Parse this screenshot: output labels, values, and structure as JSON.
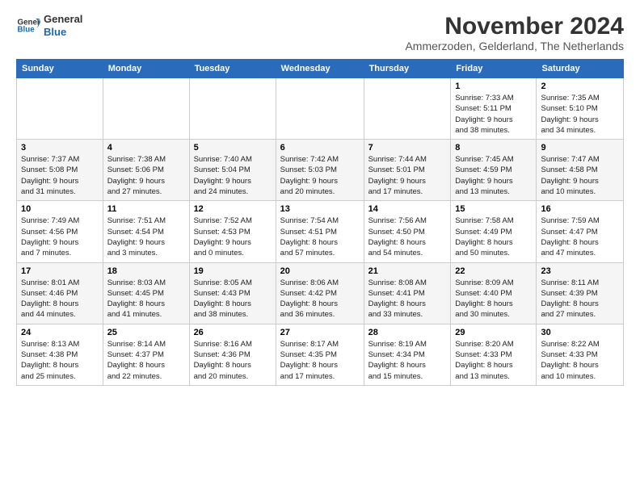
{
  "logo": {
    "line1": "General",
    "line2": "Blue"
  },
  "title": "November 2024",
  "subtitle": "Ammerzoden, Gelderland, The Netherlands",
  "weekdays": [
    "Sunday",
    "Monday",
    "Tuesday",
    "Wednesday",
    "Thursday",
    "Friday",
    "Saturday"
  ],
  "weeks": [
    [
      {
        "day": "",
        "info": ""
      },
      {
        "day": "",
        "info": ""
      },
      {
        "day": "",
        "info": ""
      },
      {
        "day": "",
        "info": ""
      },
      {
        "day": "",
        "info": ""
      },
      {
        "day": "1",
        "info": "Sunrise: 7:33 AM\nSunset: 5:11 PM\nDaylight: 9 hours\nand 38 minutes."
      },
      {
        "day": "2",
        "info": "Sunrise: 7:35 AM\nSunset: 5:10 PM\nDaylight: 9 hours\nand 34 minutes."
      }
    ],
    [
      {
        "day": "3",
        "info": "Sunrise: 7:37 AM\nSunset: 5:08 PM\nDaylight: 9 hours\nand 31 minutes."
      },
      {
        "day": "4",
        "info": "Sunrise: 7:38 AM\nSunset: 5:06 PM\nDaylight: 9 hours\nand 27 minutes."
      },
      {
        "day": "5",
        "info": "Sunrise: 7:40 AM\nSunset: 5:04 PM\nDaylight: 9 hours\nand 24 minutes."
      },
      {
        "day": "6",
        "info": "Sunrise: 7:42 AM\nSunset: 5:03 PM\nDaylight: 9 hours\nand 20 minutes."
      },
      {
        "day": "7",
        "info": "Sunrise: 7:44 AM\nSunset: 5:01 PM\nDaylight: 9 hours\nand 17 minutes."
      },
      {
        "day": "8",
        "info": "Sunrise: 7:45 AM\nSunset: 4:59 PM\nDaylight: 9 hours\nand 13 minutes."
      },
      {
        "day": "9",
        "info": "Sunrise: 7:47 AM\nSunset: 4:58 PM\nDaylight: 9 hours\nand 10 minutes."
      }
    ],
    [
      {
        "day": "10",
        "info": "Sunrise: 7:49 AM\nSunset: 4:56 PM\nDaylight: 9 hours\nand 7 minutes."
      },
      {
        "day": "11",
        "info": "Sunrise: 7:51 AM\nSunset: 4:54 PM\nDaylight: 9 hours\nand 3 minutes."
      },
      {
        "day": "12",
        "info": "Sunrise: 7:52 AM\nSunset: 4:53 PM\nDaylight: 9 hours\nand 0 minutes."
      },
      {
        "day": "13",
        "info": "Sunrise: 7:54 AM\nSunset: 4:51 PM\nDaylight: 8 hours\nand 57 minutes."
      },
      {
        "day": "14",
        "info": "Sunrise: 7:56 AM\nSunset: 4:50 PM\nDaylight: 8 hours\nand 54 minutes."
      },
      {
        "day": "15",
        "info": "Sunrise: 7:58 AM\nSunset: 4:49 PM\nDaylight: 8 hours\nand 50 minutes."
      },
      {
        "day": "16",
        "info": "Sunrise: 7:59 AM\nSunset: 4:47 PM\nDaylight: 8 hours\nand 47 minutes."
      }
    ],
    [
      {
        "day": "17",
        "info": "Sunrise: 8:01 AM\nSunset: 4:46 PM\nDaylight: 8 hours\nand 44 minutes."
      },
      {
        "day": "18",
        "info": "Sunrise: 8:03 AM\nSunset: 4:45 PM\nDaylight: 8 hours\nand 41 minutes."
      },
      {
        "day": "19",
        "info": "Sunrise: 8:05 AM\nSunset: 4:43 PM\nDaylight: 8 hours\nand 38 minutes."
      },
      {
        "day": "20",
        "info": "Sunrise: 8:06 AM\nSunset: 4:42 PM\nDaylight: 8 hours\nand 36 minutes."
      },
      {
        "day": "21",
        "info": "Sunrise: 8:08 AM\nSunset: 4:41 PM\nDaylight: 8 hours\nand 33 minutes."
      },
      {
        "day": "22",
        "info": "Sunrise: 8:09 AM\nSunset: 4:40 PM\nDaylight: 8 hours\nand 30 minutes."
      },
      {
        "day": "23",
        "info": "Sunrise: 8:11 AM\nSunset: 4:39 PM\nDaylight: 8 hours\nand 27 minutes."
      }
    ],
    [
      {
        "day": "24",
        "info": "Sunrise: 8:13 AM\nSunset: 4:38 PM\nDaylight: 8 hours\nand 25 minutes."
      },
      {
        "day": "25",
        "info": "Sunrise: 8:14 AM\nSunset: 4:37 PM\nDaylight: 8 hours\nand 22 minutes."
      },
      {
        "day": "26",
        "info": "Sunrise: 8:16 AM\nSunset: 4:36 PM\nDaylight: 8 hours\nand 20 minutes."
      },
      {
        "day": "27",
        "info": "Sunrise: 8:17 AM\nSunset: 4:35 PM\nDaylight: 8 hours\nand 17 minutes."
      },
      {
        "day": "28",
        "info": "Sunrise: 8:19 AM\nSunset: 4:34 PM\nDaylight: 8 hours\nand 15 minutes."
      },
      {
        "day": "29",
        "info": "Sunrise: 8:20 AM\nSunset: 4:33 PM\nDaylight: 8 hours\nand 13 minutes."
      },
      {
        "day": "30",
        "info": "Sunrise: 8:22 AM\nSunset: 4:33 PM\nDaylight: 8 hours\nand 10 minutes."
      }
    ]
  ]
}
